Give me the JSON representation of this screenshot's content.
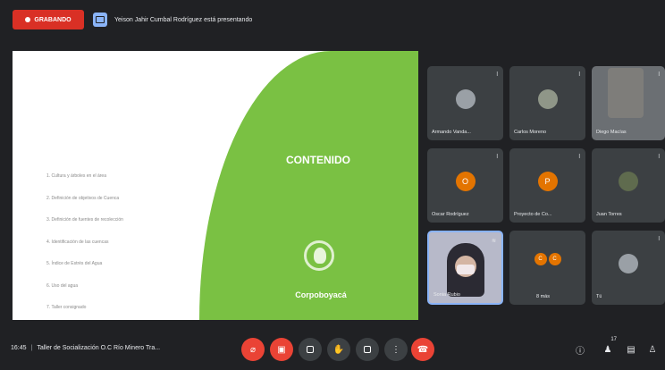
{
  "topbar": {
    "recording_label": "GRABANDO",
    "presenter_text": "Yeison Jahir Cumbal Rodríguez está presentando"
  },
  "slide": {
    "title": "CONTENIDO",
    "logo_text": "Corpoboyacá",
    "items": [
      "1. Cultura y árboles en el área",
      "2. Definición de objetivos de Cuenca",
      "3. Definición de fuentes de recolección",
      "4. Identificación de las cuencas",
      "5. Índice de Estrés del Agua",
      "6. Uso del agua",
      "7. Taller consignado"
    ]
  },
  "participants": [
    {
      "name": "Armando Vanda...",
      "initial": "",
      "style": "photo"
    },
    {
      "name": "Carlos Moreno",
      "initial": "",
      "style": "photo2"
    },
    {
      "name": "Diego Macías",
      "initial": "",
      "style": "photo-tile"
    },
    {
      "name": "Oscar Rodríguez",
      "initial": "O",
      "style": "orange"
    },
    {
      "name": "Proyecto de Co...",
      "initial": "P",
      "style": "orange"
    },
    {
      "name": "Juan Torres",
      "initial": "",
      "style": "photo3"
    },
    {
      "name": "Sonia Rubio",
      "initial": "",
      "style": "video"
    },
    {
      "name": "8 más",
      "initial": "",
      "style": "more",
      "more_initials": [
        "C",
        "C"
      ]
    },
    {
      "name": "Tú",
      "initial": "",
      "style": "self"
    }
  ],
  "bottombar": {
    "time": "16:45",
    "meeting_title": "Taller de Socialización O.C Río Minero Tra...",
    "participants_count": "17"
  },
  "colors": {
    "record": "#d93025",
    "slide_green": "#7ac143",
    "control_red": "#ea4335",
    "control_bg": "#3c4043",
    "background": "#202124"
  }
}
